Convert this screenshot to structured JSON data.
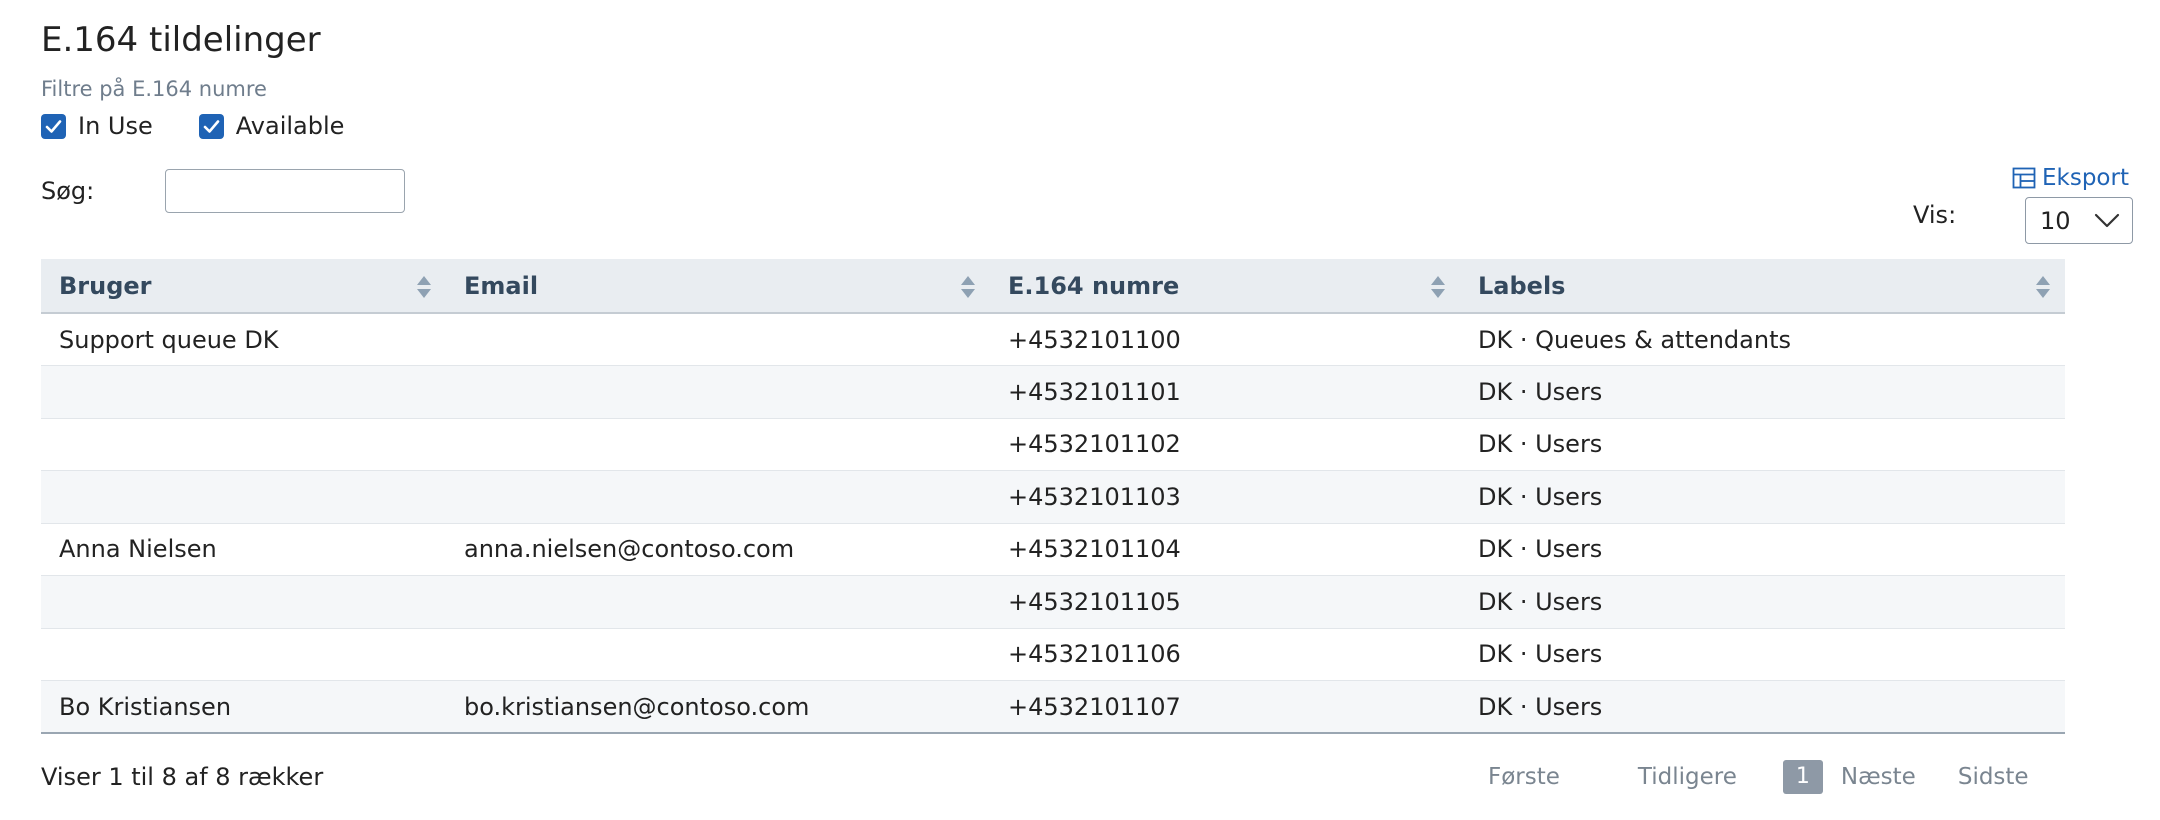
{
  "page": {
    "title": "E.164 tildelinger",
    "filter_caption": "Filtre på E.164 numre"
  },
  "filters": [
    {
      "label": "In Use",
      "checked": true
    },
    {
      "label": "Available",
      "checked": true
    }
  ],
  "search": {
    "label": "Søg:",
    "value": "",
    "placeholder": ""
  },
  "export": {
    "label": "Eksport",
    "icon": "table-icon"
  },
  "page_size": {
    "label": "Vis:",
    "selected": "10"
  },
  "table": {
    "columns": [
      {
        "label": "Bruger"
      },
      {
        "label": "Email"
      },
      {
        "label": "E.164 numre"
      },
      {
        "label": "Labels"
      }
    ],
    "rows": [
      {
        "user": "Support queue DK",
        "email": "",
        "number": "+4532101100",
        "labels": "DK · Queues & attendants"
      },
      {
        "user": "",
        "email": "",
        "number": "+4532101101",
        "labels": "DK · Users"
      },
      {
        "user": "",
        "email": "",
        "number": "+4532101102",
        "labels": "DK · Users"
      },
      {
        "user": "",
        "email": "",
        "number": "+4532101103",
        "labels": "DK · Users"
      },
      {
        "user": "Anna Nielsen",
        "email": "anna.nielsen@contoso.com",
        "number": "+4532101104",
        "labels": "DK · Users"
      },
      {
        "user": "",
        "email": "",
        "number": "+4532101105",
        "labels": "DK · Users"
      },
      {
        "user": "",
        "email": "",
        "number": "+4532101106",
        "labels": "DK · Users"
      },
      {
        "user": "Bo Kristiansen",
        "email": "bo.kristiansen@contoso.com",
        "number": "+4532101107",
        "labels": "DK · Users"
      }
    ]
  },
  "footer": {
    "info": "Viser 1 til 8 af 8 rækker"
  },
  "pagination": {
    "first": "Første",
    "previous": "Tidligere",
    "current": "1",
    "next": "Næste",
    "last": "Sidste"
  },
  "colors": {
    "accent": "#1f63b5",
    "header_bg": "#e9edf1",
    "pager_active": "#8e99a6"
  }
}
